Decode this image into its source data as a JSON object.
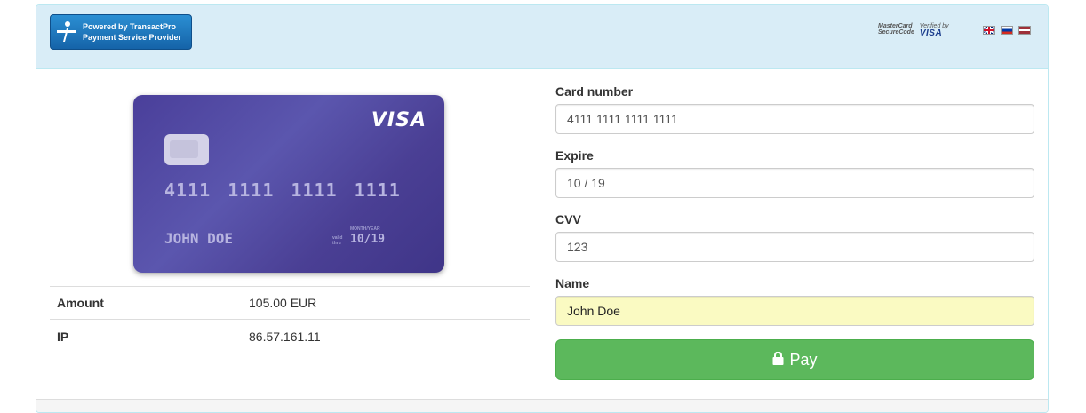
{
  "header": {
    "logo_line1": "Powered by TransactPro",
    "logo_line2": "Payment Service Provider",
    "mastercard_line1": "MasterCard",
    "mastercard_line2": "SecureCode",
    "vbv_line1": "Verified by",
    "vbv_line2": "VISA",
    "languages": [
      "en-flag-icon",
      "ru-flag-icon",
      "lv-flag-icon"
    ]
  },
  "card_preview": {
    "brand": "VISA",
    "number": "4111 1111 1111 1111",
    "holder": "JOHN DOE",
    "valid_thru_line1": "valid",
    "valid_thru_line2": "thru",
    "month_year_label": "MONTH/YEAR",
    "expiry": "10/19",
    "colors": {
      "card": "#4a3f9a"
    }
  },
  "details": {
    "rows": [
      {
        "key": "Amount",
        "value": "105.00 EUR"
      },
      {
        "key": "IP",
        "value": "86.57.161.11"
      }
    ]
  },
  "form": {
    "card_number_label": "Card number",
    "card_number_value": "4111 1111 1111 1111",
    "expire_label": "Expire",
    "expire_value": "10 / 19",
    "cvv_label": "CVV",
    "cvv_value": "123",
    "name_label": "Name",
    "name_value": "John Doe",
    "pay_label": "Pay",
    "pay_icon": "lock-icon",
    "colors": {
      "pay_button": "#5cb85c",
      "autofill": "#fafac2",
      "header": "#d9edf7"
    }
  }
}
